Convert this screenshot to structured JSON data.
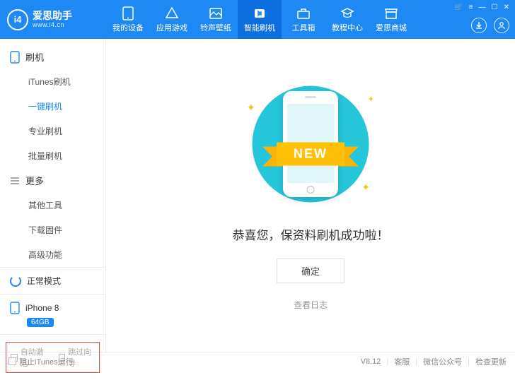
{
  "app": {
    "name": "爱思助手",
    "url": "www.i4.cn",
    "logo_text": "i4"
  },
  "window_controls": [
    "cart",
    "menu",
    "min",
    "max",
    "close"
  ],
  "nav": [
    {
      "label": "我的设备",
      "icon": "device"
    },
    {
      "label": "应用游戏",
      "icon": "apps"
    },
    {
      "label": "铃声壁纸",
      "icon": "media"
    },
    {
      "label": "智能刷机",
      "icon": "flash",
      "active": true
    },
    {
      "label": "工具箱",
      "icon": "toolbox"
    },
    {
      "label": "教程中心",
      "icon": "tutorial"
    },
    {
      "label": "爱思商城",
      "icon": "store"
    }
  ],
  "sidebar": {
    "groups": [
      {
        "title": "刷机",
        "icon": "phone-outline",
        "items": [
          {
            "label": "iTunes刷机"
          },
          {
            "label": "一键刷机",
            "active": true
          },
          {
            "label": "专业刷机"
          },
          {
            "label": "批量刷机"
          }
        ]
      },
      {
        "title": "更多",
        "icon": "menu-lines",
        "items": [
          {
            "label": "其他工具"
          },
          {
            "label": "下载固件"
          },
          {
            "label": "高级功能"
          }
        ]
      }
    ],
    "mode": {
      "label": "正常模式"
    },
    "device": {
      "name": "iPhone 8",
      "storage": "64GB"
    },
    "bottom": {
      "auto_activate": "自动激活",
      "skip_wizard": "跳过向导"
    }
  },
  "content": {
    "ribbon": "NEW",
    "message": "恭喜您，保资料刷机成功啦！",
    "ok_btn": "确定",
    "log_link": "查看日志"
  },
  "footer": {
    "block_itunes": "阻止iTunes运行",
    "version": "V8.12",
    "support": "客服",
    "wechat": "微信公众号",
    "update": "检查更新"
  }
}
